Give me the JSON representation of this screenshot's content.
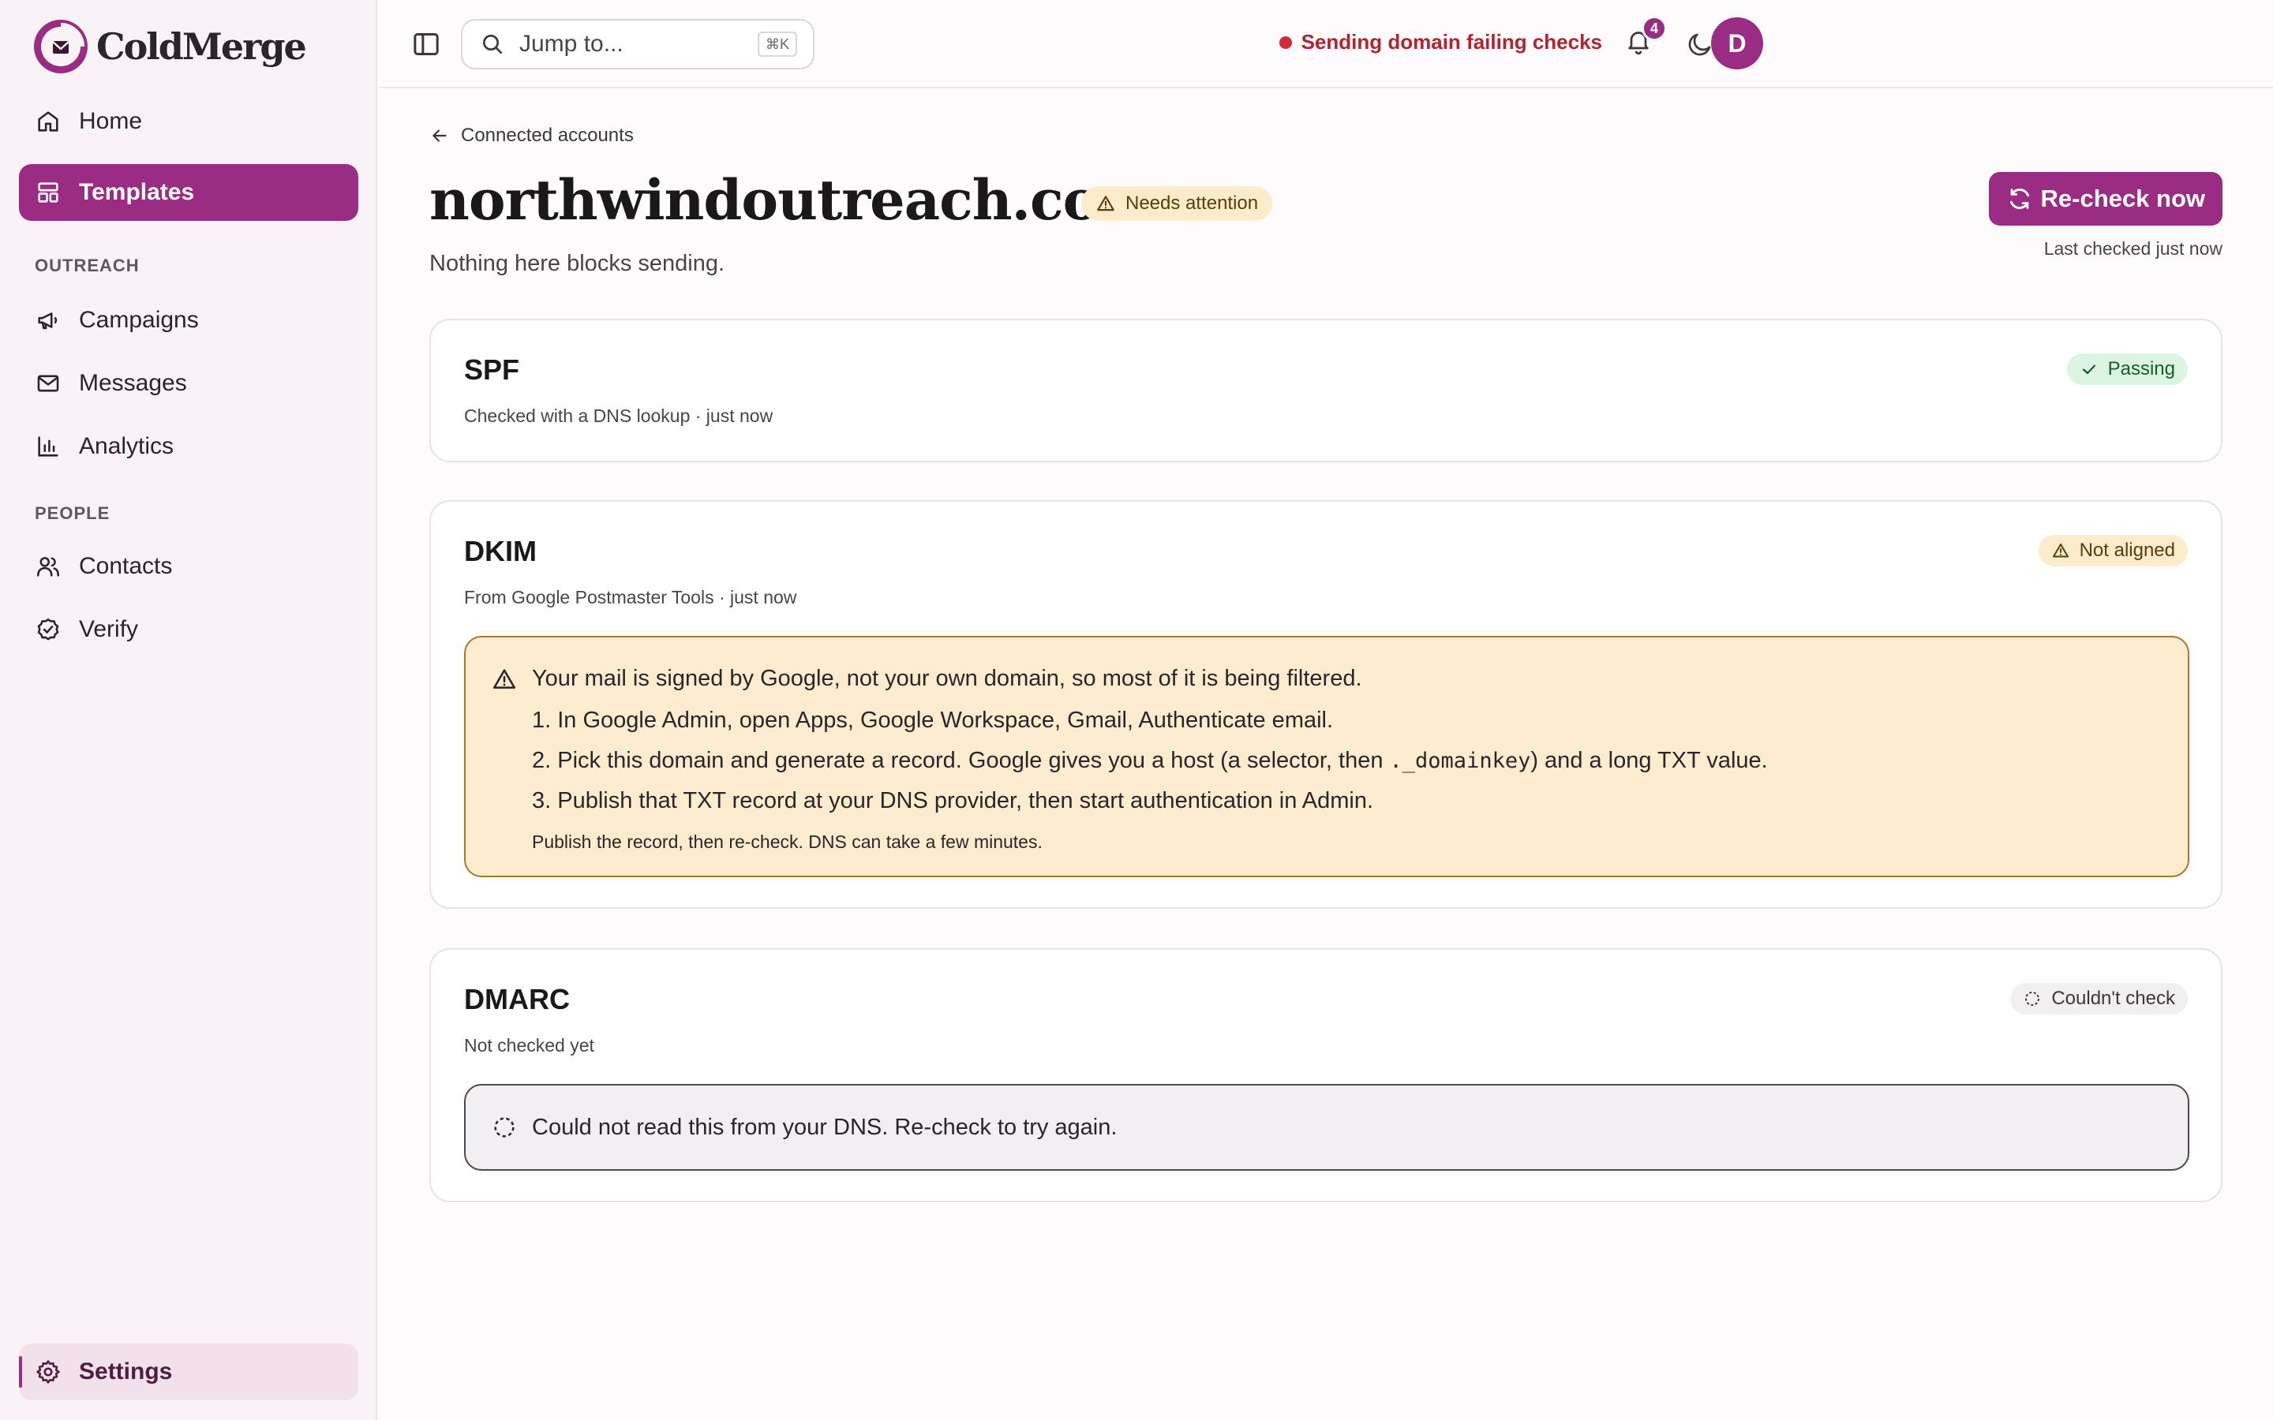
{
  "brand": {
    "name": "ColdMerge",
    "accent": "#9a2d83"
  },
  "sidebar": {
    "items": [
      {
        "label": "Home",
        "icon": "home-icon"
      },
      {
        "label": "Templates",
        "icon": "layout-icon",
        "active": true
      }
    ],
    "sections": [
      {
        "title": "OUTREACH",
        "items": [
          {
            "label": "Campaigns",
            "icon": "megaphone-icon"
          },
          {
            "label": "Messages",
            "icon": "mail-icon"
          },
          {
            "label": "Analytics",
            "icon": "bar-chart-icon"
          }
        ]
      },
      {
        "title": "PEOPLE",
        "items": [
          {
            "label": "Contacts",
            "icon": "users-icon"
          },
          {
            "label": "Verify",
            "icon": "check-badge-icon"
          }
        ]
      }
    ],
    "settings": {
      "label": "Settings",
      "icon": "gear-icon"
    }
  },
  "topbar": {
    "search_placeholder": "Jump to...",
    "search_shortcut": "⌘K",
    "status_text": "Sending domain failing checks",
    "notification_count": "4",
    "avatar_initial": "D"
  },
  "page": {
    "back_label": "Connected accounts",
    "title": "northwindoutreach.com",
    "status_badge": "Needs attention",
    "subtitle": "Nothing here blocks sending.",
    "recheck_label": "Re-check now",
    "last_checked": "Last checked just now"
  },
  "checks": {
    "spf": {
      "title": "SPF",
      "sub": "Checked with a DNS lookup · just now",
      "status": "Passing"
    },
    "dkim": {
      "title": "DKIM",
      "sub": "From Google Postmaster Tools · just now",
      "status": "Not aligned",
      "lead": "Your mail is signed by Google, not your own domain, so most of it is being filtered.",
      "step1": "1. In Google Admin, open Apps, Google Workspace, Gmail, Authenticate email.",
      "step2_pre": "2. Pick this domain and generate a record. Google gives you a host (a selector, then ",
      "step2_code": "._domainkey",
      "step2_post": ") and a long TXT value.",
      "step3": "3. Publish that TXT record at your DNS provider, then start authentication in Admin.",
      "note": "Publish the record, then re-check. DNS can take a few minutes."
    },
    "dmarc": {
      "title": "DMARC",
      "sub": "Not checked yet",
      "status": "Couldn't check",
      "message": "Could not read this from your DNS. Re-check to try again."
    }
  },
  "colors": {
    "pass": "#155d2b",
    "warn": "#5a3d08",
    "error": "#b4232f"
  }
}
